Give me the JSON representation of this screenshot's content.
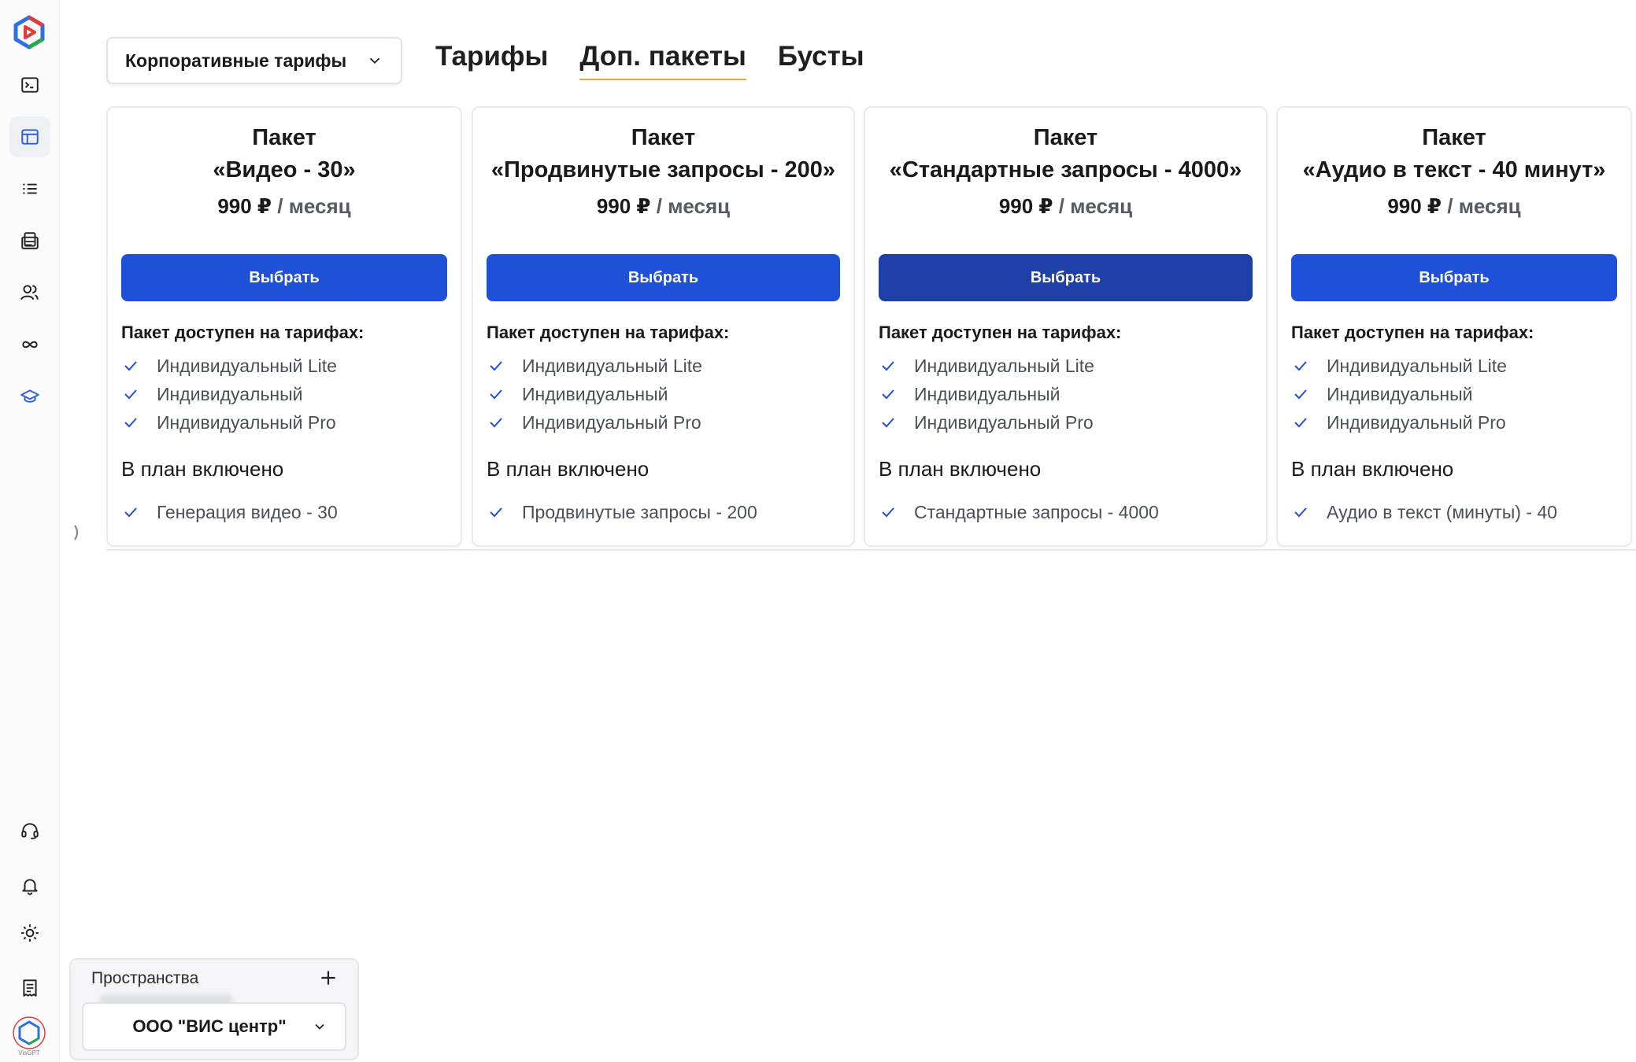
{
  "header": {
    "dropdown_label": "Корпоративные тарифы",
    "tabs": [
      {
        "label": "Тарифы",
        "active": false
      },
      {
        "label": "Доп. пакеты",
        "active": true
      },
      {
        "label": "Бусты",
        "active": false
      }
    ]
  },
  "sidebar": {
    "icons": [
      "terminal-icon",
      "layout-icon",
      "list-icon",
      "document-stack-icon",
      "users-icon",
      "infinity-icon",
      "graduation-cap-icon",
      "headset-icon",
      "bell-icon",
      "sun-icon",
      "receipt-icon"
    ],
    "active_index": 1
  },
  "cards": [
    {
      "title_line1": "Пакет",
      "title_line2": "«Видео - 30»",
      "price": "990 ₽",
      "period": " / месяц",
      "button": "Выбрать",
      "available_title": "Пакет доступен на тарифах:",
      "available": [
        "Индивидуальный Lite",
        "Индивидуальный",
        "Индивидуальный Pro"
      ],
      "included_title": "В план включено",
      "included": [
        "Генерация видео - 30"
      ]
    },
    {
      "title_line1": "Пакет",
      "title_line2": "«Продвинутые запросы - 200»",
      "price": "990 ₽",
      "period": " / месяц",
      "button": "Выбрать",
      "available_title": "Пакет доступен на тарифах:",
      "available": [
        "Индивидуальный Lite",
        "Индивидуальный",
        "Индивидуальный Pro"
      ],
      "included_title": "В план включено",
      "included": [
        "Продвинутые запросы - 200"
      ]
    },
    {
      "title_line1": "Пакет",
      "title_line2": "«Стандартные запросы - 4000»",
      "price": "990 ₽",
      "period": " / месяц",
      "button": "Выбрать",
      "available_title": "Пакет доступен на тарифах:",
      "available": [
        "Индивидуальный Lite",
        "Индивидуальный",
        "Индивидуальный Pro"
      ],
      "included_title": "В план включено",
      "included": [
        "Стандартные запросы - 4000"
      ]
    },
    {
      "title_line1": "Пакет",
      "title_line2": "«Аудио в текст - 40 минут»",
      "price": "990 ₽",
      "period": " / месяц",
      "button": "Выбрать",
      "available_title": "Пакет доступен на тарифах:",
      "available": [
        "Индивидуальный Lite",
        "Индивидуальный",
        "Индивидуальный Pro"
      ],
      "included_title": "В план включено",
      "included": [
        "Аудио в текст (минуты) - 40"
      ]
    }
  ],
  "spaces": {
    "label": "Пространства",
    "selected": "ООО \"ВИС центр\""
  },
  "brand": {
    "accent": "#1f50d8",
    "accent_hover": "#1e3fa8",
    "tab_underline": "#e8a93b",
    "small_logo_text": "VisGPT"
  }
}
